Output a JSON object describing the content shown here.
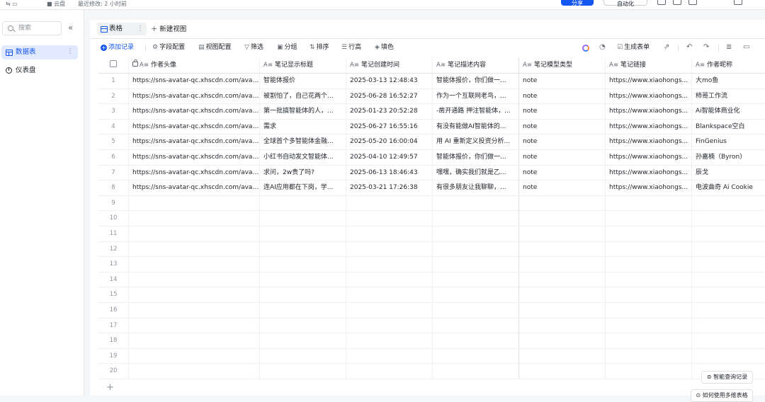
{
  "topbar": {
    "folder": "云盘",
    "modified": "最近修改: 2 小时前",
    "share_label": "分享",
    "automation_label": "自动化"
  },
  "sidebar": {
    "search_placeholder": "搜索",
    "collapse": "«",
    "items": [
      {
        "label": "数据表",
        "active": true
      },
      {
        "label": "仪表盘",
        "active": false
      }
    ]
  },
  "tabs": {
    "active_tab": "表格",
    "more": "⋮",
    "new_view": "新建视图"
  },
  "toolbar": {
    "add_record": "添加记录",
    "field_config": "字段配置",
    "view_config": "视图配置",
    "filter": "筛选",
    "group": "分组",
    "sort": "排序",
    "row_height": "行高",
    "fill": "填色",
    "generate_form": "生成表单"
  },
  "table": {
    "columns": [
      "作者头像",
      "笔记显示标题",
      "笔记创建时间",
      "笔记描述内容",
      "笔记模型类型",
      "笔记链接",
      "作者昵称"
    ],
    "rows": [
      [
        "https://sns-avatar-qc.xhscdn.com/avat...",
        "智能体报价",
        "2025-03-13 12:48:43",
        "智能体报价，你们做一...",
        "note",
        "https://www.xiaohongs...",
        "大mo鱼"
      ],
      [
        "https://sns-avatar-qc.xhscdn.com/avat...",
        "被割怕了，自己花两个...",
        "2025-06-28 16:52:27",
        "作为一个互联网老鸟，...",
        "note",
        "https://www.xiaohongs...",
        "柿哥工作流"
      ],
      [
        "https://sns-avatar-qc.xhscdn.com/avat...",
        "第一批搞智能体的人，...",
        "2025-01-23 20:52:28",
        "-凿开通路 押注智能体，...",
        "note",
        "https://www.xiaohongs...",
        "Ai智能体商业化"
      ],
      [
        "https://sns-avatar-qc.xhscdn.com/avat...",
        "需求",
        "2025-06-27 16:55:16",
        "有没有能做AI智能体的...",
        "note",
        "https://www.xiaohongs...",
        "Blankspace空白"
      ],
      [
        "https://sns-avatar-qc.xhscdn.com/avat...",
        "全球首个多智能体金融...",
        "2025-05-20 16:00:04",
        "用 AI 重新定义投资分析...",
        "note",
        "https://www.xiaohongs...",
        "FinGenius"
      ],
      [
        "https://sns-avatar-qc.xhscdn.com/avat...",
        "小红书自动发文智能体...",
        "2025-04-10 12:49:57",
        "智能体报价，你们做一...",
        "note",
        "https://www.xiaohongs...",
        "孙嘉楠（Byron）"
      ],
      [
        "https://sns-avatar-qc.xhscdn.com/avat...",
        "求问，2w贵了吗?",
        "2025-06-13 18:46:43",
        "嘿嘿，确实我们就是乙...",
        "note",
        "https://www.xiaohongs...",
        "辰戈"
      ],
      [
        "https://sns-avatar-qc.xhscdn.com/avat...",
        "连AI应用都在下岗，学...",
        "2025-03-21 17:26:38",
        "有很多朋友让我聊聊，...",
        "note",
        "https://www.xiaohongs...",
        "电波曲奇 Ai Cookie"
      ]
    ],
    "row_numbers": [
      "1",
      "2",
      "3",
      "4",
      "5",
      "6",
      "7",
      "8",
      "9",
      "10",
      "11",
      "12",
      "13",
      "14",
      "15",
      "16",
      "17",
      "18",
      "19",
      "20"
    ]
  },
  "footer": {
    "add_row": "+",
    "smart_query": "智能查询记录",
    "how_to": "如何使用多维表格"
  },
  "colors": {
    "accent": "#1456f0",
    "active_bg": "#e1eaff"
  }
}
